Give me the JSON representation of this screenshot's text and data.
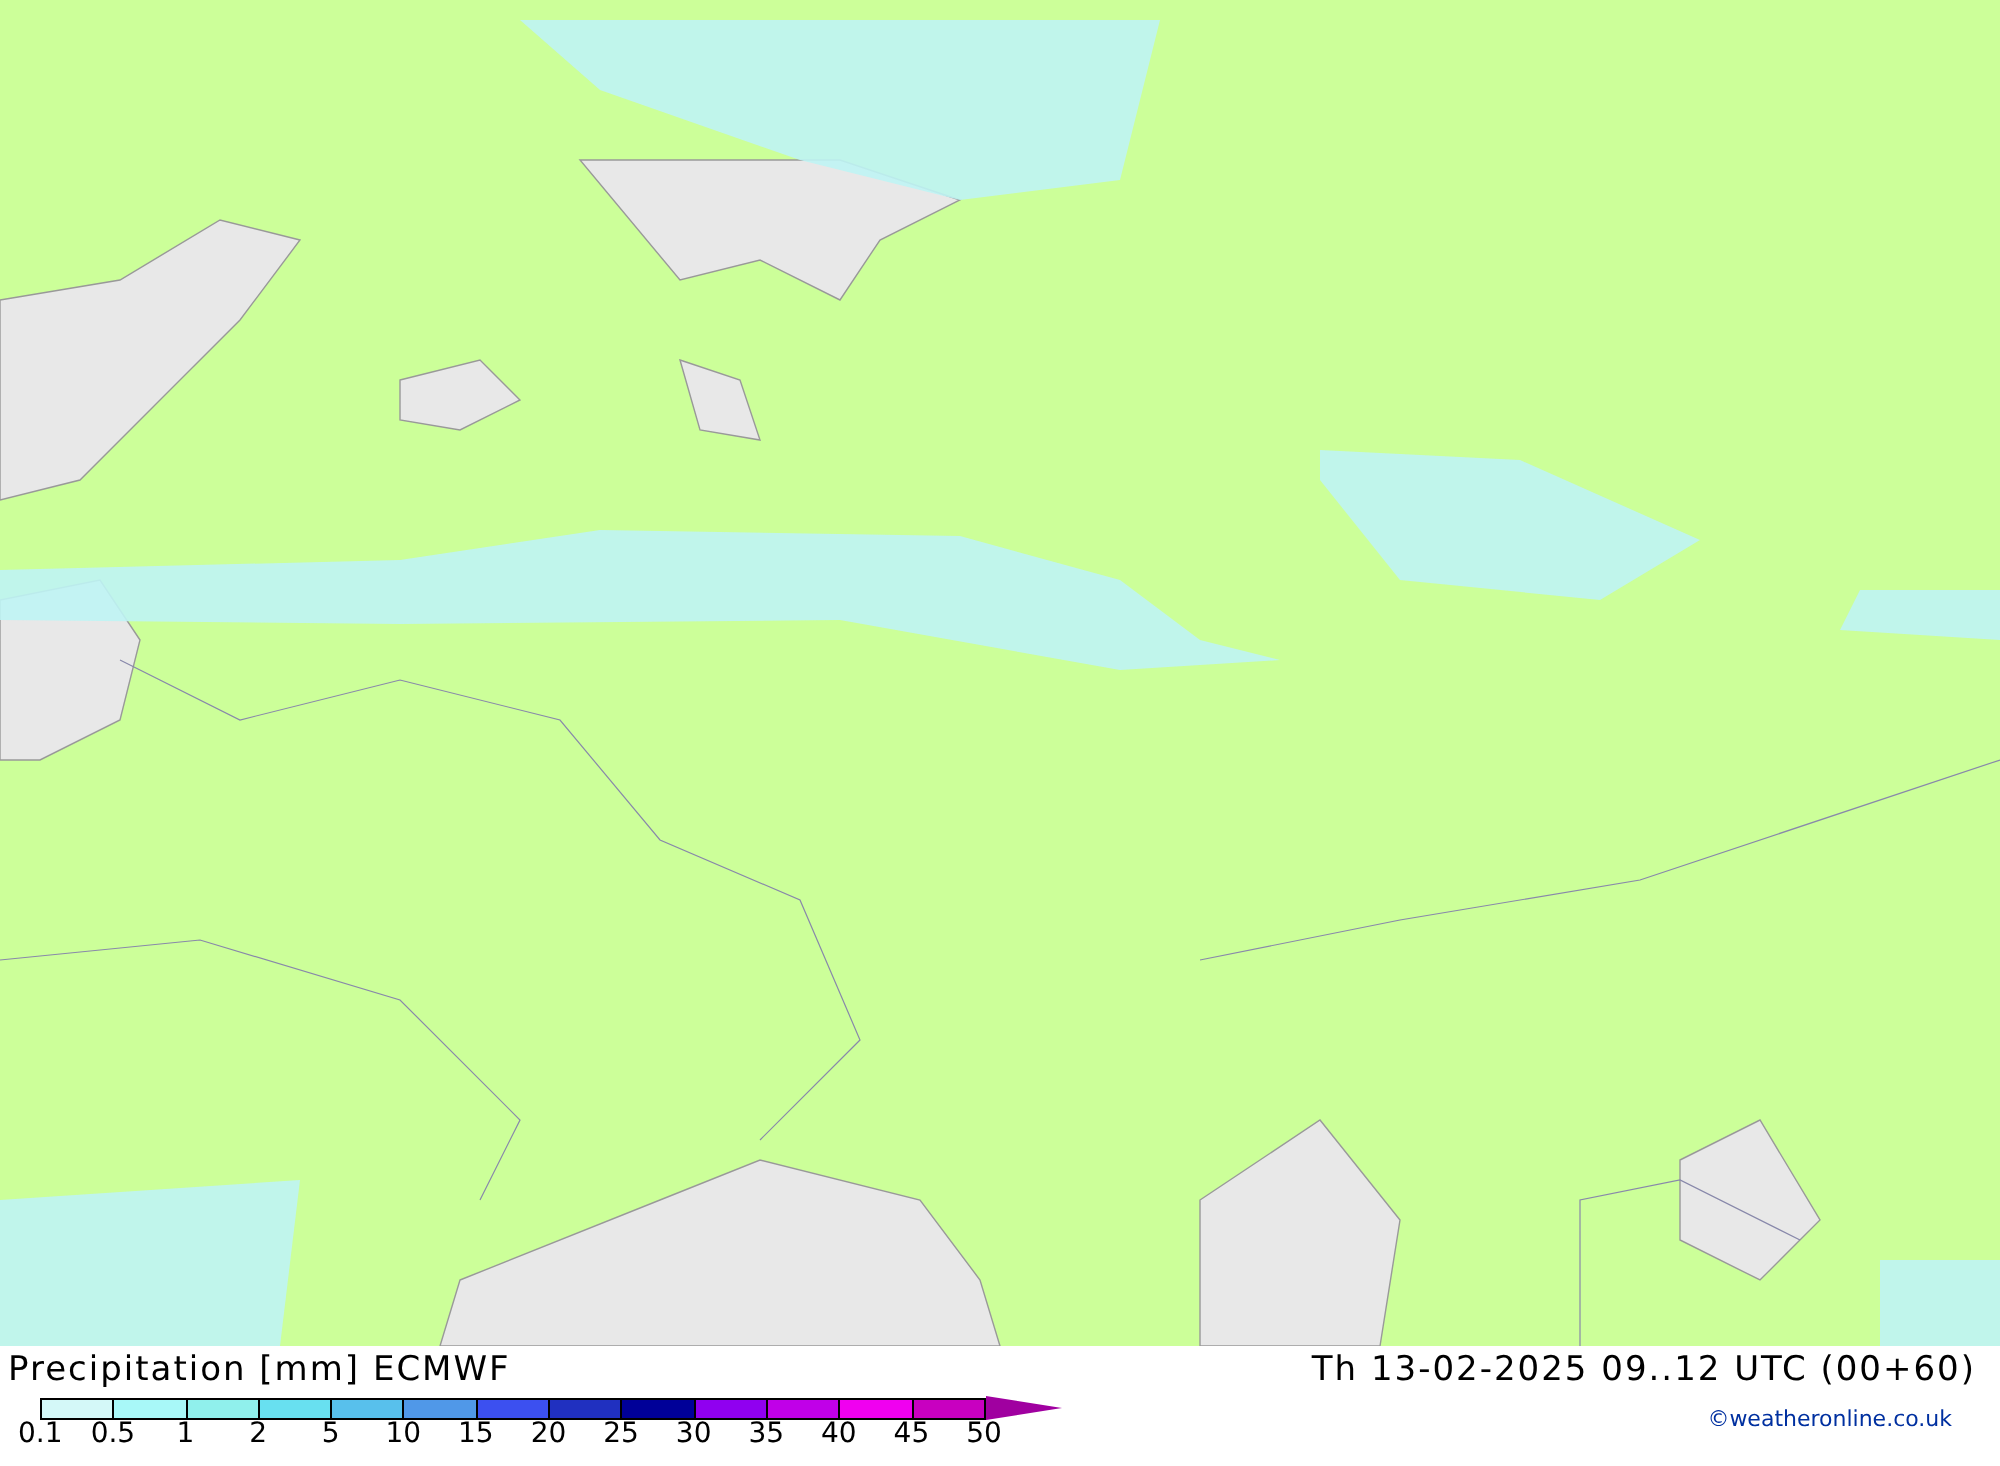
{
  "title": "Precipitation [mm] ECMWF",
  "valid_time": "Th 13-02-2025 09..12 UTC (00+60)",
  "legend": {
    "swatches": [
      {
        "color": "#d4f8f8"
      },
      {
        "color": "#a8f8f8"
      },
      {
        "color": "#90f0ec"
      },
      {
        "color": "#68e0f0"
      },
      {
        "color": "#58c0ec"
      },
      {
        "color": "#5098e8"
      },
      {
        "color": "#3c50f0"
      },
      {
        "color": "#2030c0"
      },
      {
        "color": "#000098"
      },
      {
        "color": "#9000f0"
      },
      {
        "color": "#c000e8"
      },
      {
        "color": "#f000f0"
      },
      {
        "color": "#c800c0"
      }
    ],
    "labels": [
      "0.1",
      "0.5",
      "1",
      "2",
      "5",
      "10",
      "15",
      "20",
      "25",
      "30",
      "35",
      "40",
      "45",
      "50"
    ]
  },
  "credit": "©weatheronline.co.uk"
}
